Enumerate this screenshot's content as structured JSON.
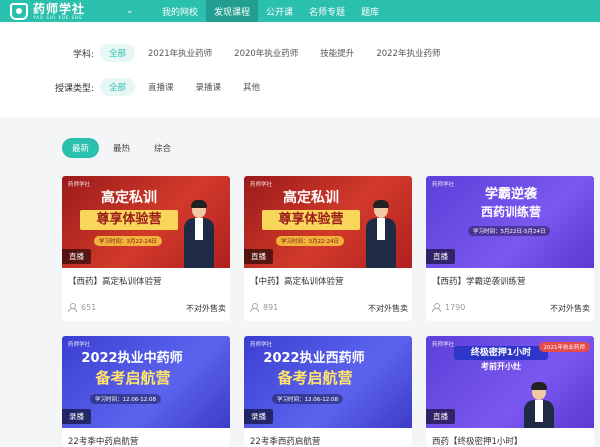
{
  "nav": {
    "logo_cn": "药师学社",
    "logo_en": "YAO SHI XUE SHE",
    "items": [
      {
        "label": "我的网校",
        "active": false
      },
      {
        "label": "发现课程",
        "active": true
      },
      {
        "label": "公开课",
        "active": false
      },
      {
        "label": "名师专题",
        "active": false
      },
      {
        "label": "题库",
        "active": false
      }
    ]
  },
  "filters": {
    "subject_label": "学科:",
    "subjects": [
      "全部",
      "2021年执业药师",
      "2020年执业药师",
      "技能提升",
      "2022年执业药师"
    ],
    "type_label": "授课类型:",
    "types": [
      "全部",
      "直播课",
      "录播课",
      "其他"
    ]
  },
  "sort_tabs": [
    "最新",
    "最热",
    "综合"
  ],
  "cards": [
    {
      "title": "【西药】高定私训体验营",
      "count": "651",
      "sale": "不对外售卖",
      "badge": "直播",
      "thumb": {
        "style": "red",
        "line1": "高定私训",
        "line2": "尊享体验营",
        "pill": "学习时间：3月22-24日",
        "logo": "药师学社"
      }
    },
    {
      "title": "【中药】高定私训体验营",
      "count": "891",
      "sale": "不对外售卖",
      "badge": "直播",
      "thumb": {
        "style": "red",
        "line1": "高定私训",
        "line2": "尊享体验营",
        "pill": "学习时间：3月22-24日",
        "logo": "药师学社"
      }
    },
    {
      "title": "【西药】学霸逆袭训练营",
      "count": "1790",
      "sale": "不对外售卖",
      "badge": "直播",
      "thumb": {
        "style": "purple",
        "line1": "学霸逆袭",
        "line2": "西药训练营",
        "pill": "学习时间：5月22日-5月24日",
        "logo": "药师学社"
      }
    },
    {
      "title": "22考季中药启航营",
      "count": "",
      "sale": "",
      "badge": "录播",
      "thumb": {
        "style": "blue",
        "line1": "2022执业中药师",
        "line2": "备考启航营",
        "pill": "学习时间：12.06-12.08",
        "logo": "药师学社"
      }
    },
    {
      "title": "22考季西药启航营",
      "count": "",
      "sale": "",
      "badge": "录播",
      "thumb": {
        "style": "blue",
        "line1": "2022执业西药师",
        "line2": "备考启航营",
        "pill": "学习时间：12.06-12.08",
        "logo": "药师学社"
      }
    },
    {
      "title": "西药【终极密押1小时】",
      "count": "",
      "sale": "",
      "badge": "直播",
      "thumb": {
        "style": "purple",
        "line1": "终极密押1小时",
        "line2": "考前开小灶",
        "pill": "2021年执业药师",
        "logo": "药师学社"
      }
    }
  ],
  "colors": {
    "brand": "#2bbfae",
    "brand_dark": "#219e90",
    "active_bg": "#e6f7f5"
  }
}
